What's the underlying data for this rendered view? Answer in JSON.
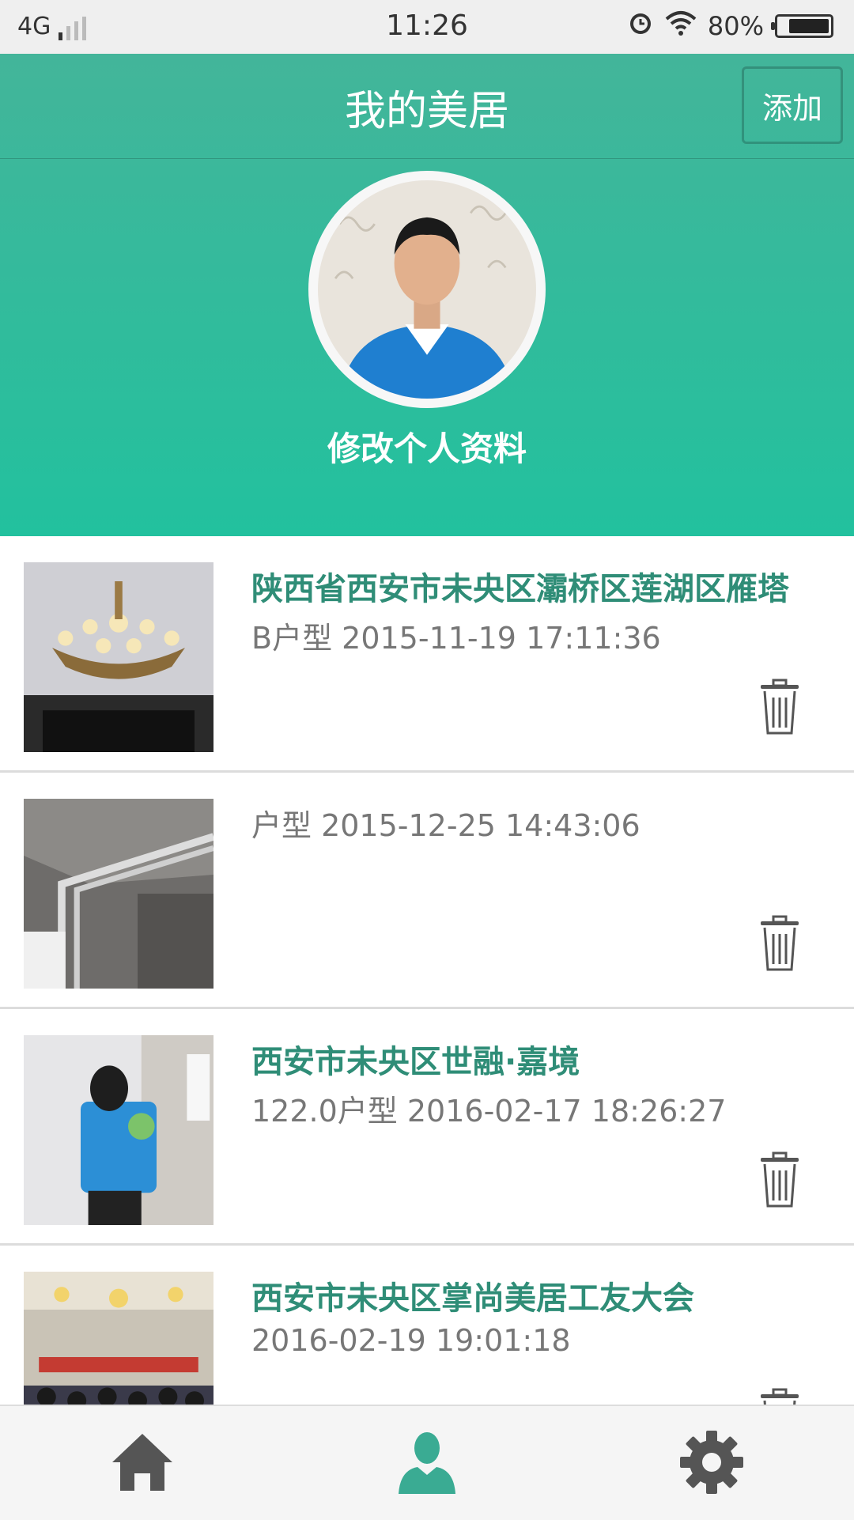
{
  "status_bar": {
    "network": "4G",
    "time": "11:26",
    "battery": "80%",
    "battery_level": 0.8
  },
  "header": {
    "title": "我的美居",
    "add_label": "添加",
    "edit_profile_label": "修改个人资料"
  },
  "list": {
    "items": [
      {
        "title": "陕西省西安市未央区灞桥区莲湖区雁塔",
        "subtitle": "B户型 2015-11-19 17:11:36"
      },
      {
        "title": "",
        "subtitle": "户型 2015-12-25 14:43:06"
      },
      {
        "title": "西安市未央区世融·嘉境",
        "subtitle": "122.0户型 2016-02-17 18:26:27"
      },
      {
        "title": "西安市未央区掌尚美居工友大会",
        "subtitle": "2016-02-19 19:01:18"
      }
    ]
  },
  "bottom_nav": {
    "items": [
      {
        "name": "home-icon",
        "active": false
      },
      {
        "name": "user-icon",
        "active": true
      },
      {
        "name": "settings-icon",
        "active": false
      }
    ],
    "active_color": "#3aab93",
    "inactive_color": "#555555"
  },
  "colors": {
    "accent": "#2f8d77",
    "header_top": "#43b59a",
    "header_bottom": "#22c19e"
  }
}
